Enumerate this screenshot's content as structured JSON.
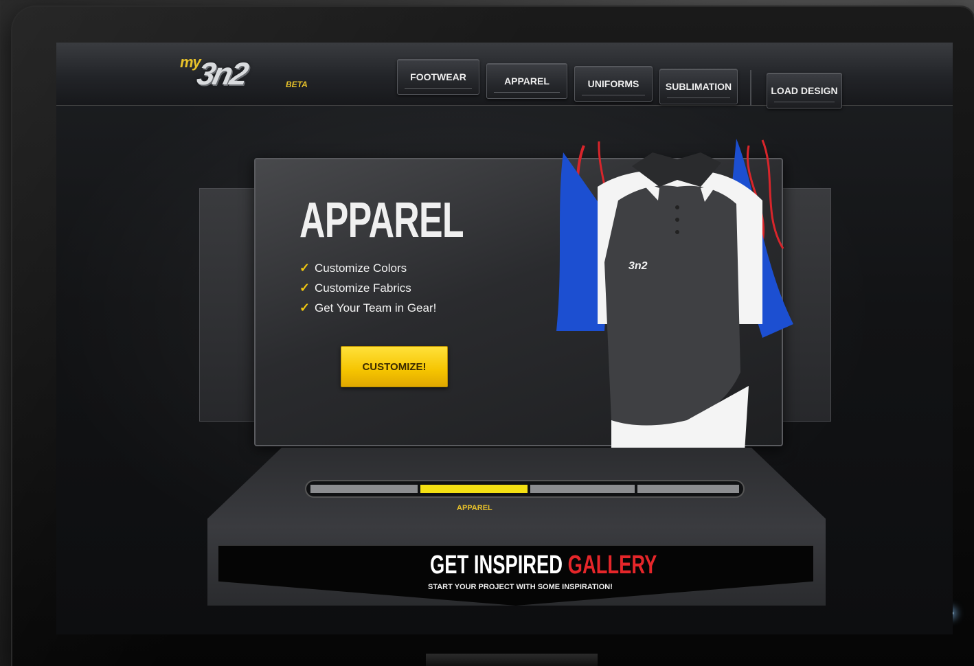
{
  "logo": {
    "prefix": "my",
    "mark": "3n2",
    "badge": "BETA"
  },
  "nav": {
    "items": [
      {
        "label": "FOOTWEAR"
      },
      {
        "label": "APPAREL"
      },
      {
        "label": "UNIFORMS"
      },
      {
        "label": "SUBLIMATION"
      }
    ],
    "load_design": "LOAD DESIGN"
  },
  "hero": {
    "title": "APPAREL",
    "features": [
      "Customize Colors",
      "Customize Fabrics",
      "Get Your Team in Gear!"
    ],
    "cta": "CUSTOMIZE!"
  },
  "carousel": {
    "segments": 4,
    "active_index": 1,
    "active_label": "APPAREL"
  },
  "gallery": {
    "title_main": "GET INSPIRED",
    "title_accent": "GALLERY",
    "subtitle": "START YOUR PROJECT WITH SOME INSPIRATION!"
  },
  "shirt": {
    "chest_logo": "3n2"
  },
  "colors": {
    "accent_yellow": "#f5c400",
    "gallery_red": "#e5262a",
    "shirt_blue": "#1c4fd1",
    "shirt_red": "#d8252b"
  }
}
